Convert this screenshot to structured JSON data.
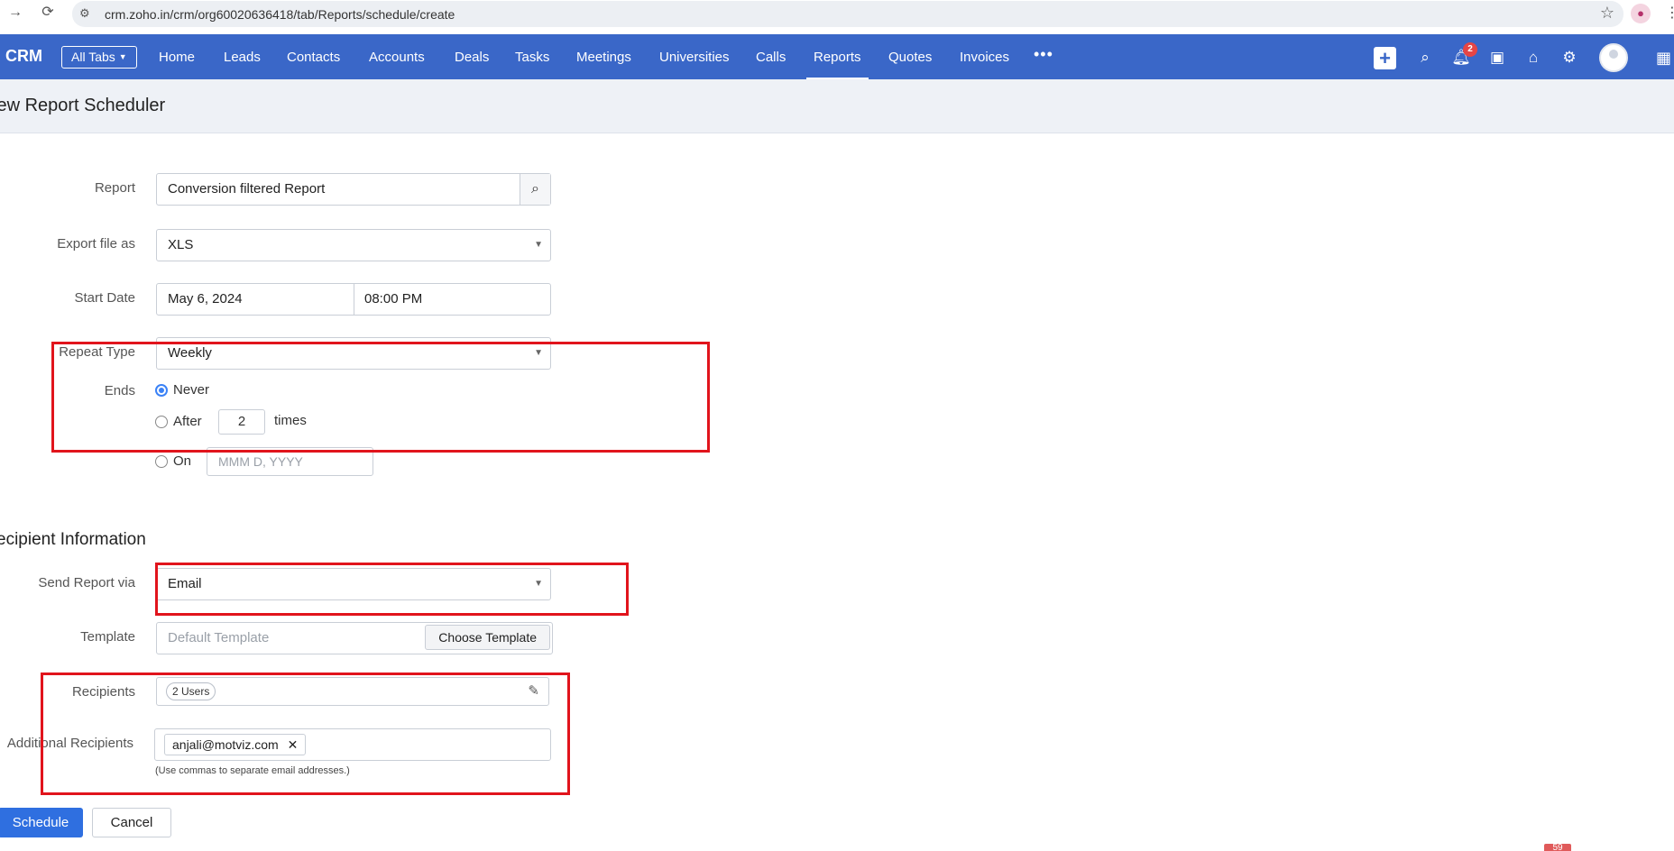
{
  "browser": {
    "url": "crm.zoho.in/crm/org60020636418/tab/Reports/schedule/create",
    "icons": [
      "forward-icon",
      "reload-icon",
      "site-settings-icon",
      "bookmark-star-icon",
      "profile-icon",
      "menu-icon"
    ]
  },
  "navbar": {
    "brand": "CRM",
    "all_tabs_label": "All Tabs",
    "tabs": [
      "Home",
      "Leads",
      "Contacts",
      "Accounts",
      "Deals",
      "Tasks",
      "Meetings",
      "Universities",
      "Calls",
      "Reports",
      "Quotes",
      "Invoices"
    ],
    "active_tab": "Reports",
    "notification_count": "2",
    "accent_color": "#3a67c8"
  },
  "page": {
    "title": "lew Report Scheduler"
  },
  "form": {
    "report_label": "Report",
    "report_value": "Conversion filtered Report",
    "export_label": "Export file as",
    "export_value": "XLS",
    "start_date_label": "Start Date",
    "start_date_value": "May 6, 2024",
    "start_time_value": "08:00 PM",
    "repeat_type_label": "Repeat Type",
    "repeat_type_value": "Weekly",
    "ends_label": "Ends",
    "ends_never": "Never",
    "ends_after": "After",
    "ends_after_count": "2",
    "ends_after_suffix": "times",
    "ends_on": "On",
    "ends_on_placeholder": "MMM D, YYYY",
    "ends_selected": "Never"
  },
  "recipients": {
    "section_title": "ecipient Information",
    "send_via_label": "Send Report via",
    "send_via_value": "Email",
    "template_label": "Template",
    "template_placeholder": "Default Template",
    "choose_template_label": "Choose Template",
    "recipients_label": "Recipients",
    "recipients_value": "2 Users",
    "additional_label": "Additional Recipients",
    "additional_chip": "anjali@motviz.com",
    "hint": "(Use commas to separate email addresses.)"
  },
  "actions": {
    "schedule_label": "Schedule",
    "cancel_label": "Cancel"
  },
  "corner_badge": "59",
  "highlight_color": "#e1141c"
}
